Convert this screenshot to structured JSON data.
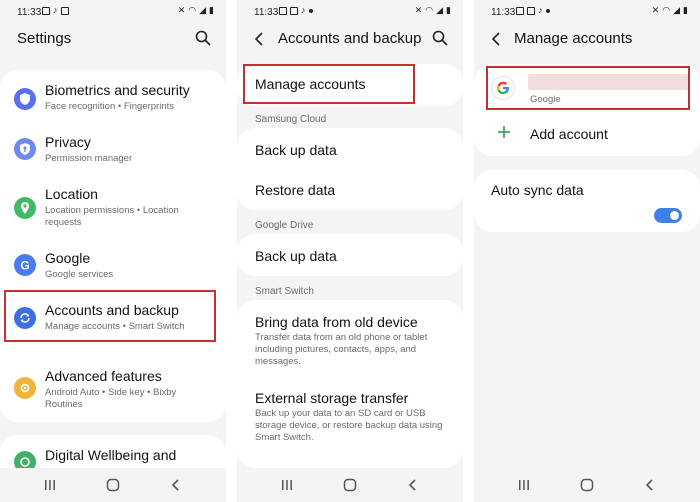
{
  "screen1": {
    "status_time": "11:33",
    "title": "Settings",
    "items": [
      {
        "title": "Biometrics and security",
        "subtitle": "Face recognition  •  Fingerprints",
        "icon": "shield-icon",
        "color": "#5b6ef2"
      },
      {
        "title": "Privacy",
        "subtitle": "Permission manager",
        "icon": "privacy-icon",
        "color": "#6d8af0"
      },
      {
        "title": "Location",
        "subtitle": "Location permissions  •  Location requests",
        "icon": "location-pin-icon",
        "color": "#45b866"
      },
      {
        "title": "Google",
        "subtitle": "Google services",
        "icon": "google-g-icon",
        "color": "#4a7bf0"
      },
      {
        "title": "Accounts and backup",
        "subtitle": "Manage accounts  •  Smart Switch",
        "icon": "sync-icon",
        "color": "#3d6fe0"
      },
      {
        "title": "Advanced features",
        "subtitle": "Android Auto  •  Side key  •  Bixby Routines",
        "icon": "advanced-features-icon",
        "color": "#f0b43a"
      },
      {
        "title": "Digital Wellbeing and",
        "subtitle": "",
        "icon": "wellbeing-icon",
        "color": "#43b06a"
      }
    ]
  },
  "screen2": {
    "status_time": "11:33",
    "title": "Accounts and backup",
    "manage_accounts": "Manage accounts",
    "sections": {
      "samsung_cloud": "Samsung Cloud",
      "google_drive": "Google Drive",
      "smart_switch": "Smart Switch"
    },
    "back_up_data": "Back up data",
    "restore_data": "Restore data",
    "drive_back_up": "Back up data",
    "bring_data": {
      "title": "Bring data from old device",
      "subtitle": "Transfer data from an old phone or tablet including pictures, contacts, apps, and messages."
    },
    "external_storage": {
      "title": "External storage transfer",
      "subtitle": "Back up your data to an SD card or USB storage device, or restore backup data using Smart Switch."
    }
  },
  "screen3": {
    "status_time": "11:33",
    "title": "Manage accounts",
    "account_provider": "Google",
    "add_account": "Add account",
    "auto_sync": "Auto sync data",
    "auto_sync_on": true,
    "accent": "#3e82e8"
  },
  "colors": {
    "highlight": "#c2312e",
    "background": "#f4f4f4",
    "card": "#ffffff"
  }
}
